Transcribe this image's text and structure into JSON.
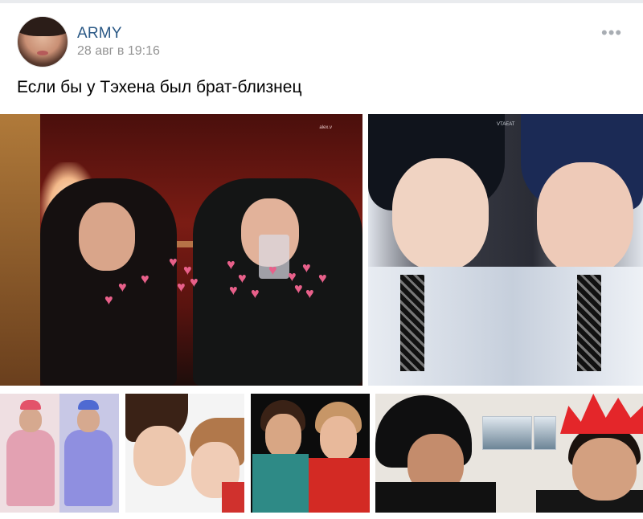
{
  "post": {
    "author": "ARMY",
    "time": "28 авг в 19:16",
    "more_icon": "more-horizontal-icon",
    "text": "Если бы у Тэхена был брат-близнец"
  },
  "colors": {
    "author_link": "#2a5885",
    "meta_text": "#939393",
    "heart_pink": "#e8608a"
  },
  "photos": {
    "p1_watermark": "alex.v",
    "p2_watermark": "VTAEAT"
  }
}
